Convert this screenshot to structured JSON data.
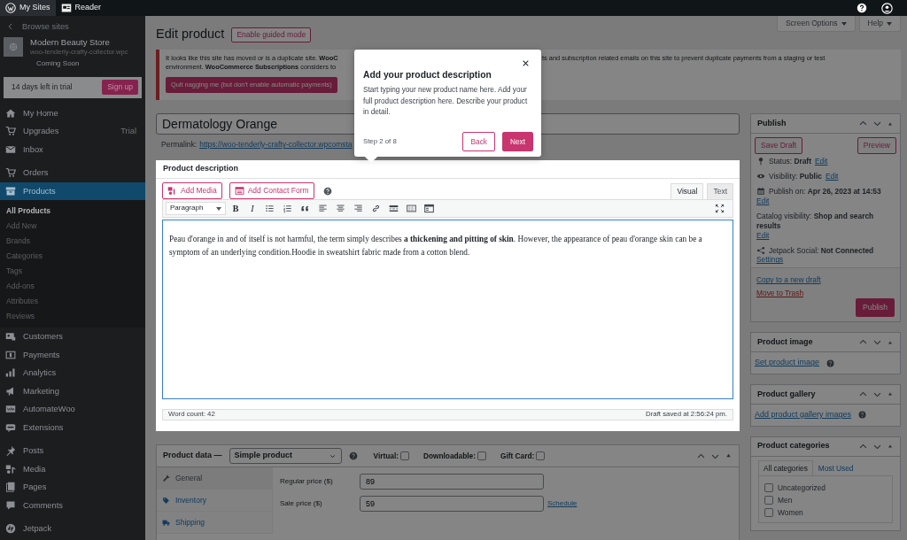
{
  "topbar": {
    "items": [
      {
        "label": "My Sites",
        "selected": true
      },
      {
        "label": "Reader",
        "selected": false
      }
    ]
  },
  "sidebar": {
    "back": "Browse sites",
    "site_name": "Modern Beauty Store",
    "site_url": "woo-tenderly-crafty-collector.wpc",
    "site_status": "Coming Soon",
    "trial_text": "14 days left in trial",
    "trial_button": "Sign up",
    "groups": [
      [
        {
          "label": "My Home",
          "selected": false
        },
        {
          "label": "Upgrades",
          "badge": "Trial",
          "selected": false
        },
        {
          "label": "Inbox",
          "selected": false
        }
      ],
      [
        {
          "label": "Orders",
          "selected": false
        },
        {
          "label": "Products",
          "selected": true,
          "children": [
            {
              "label": "All Products",
              "selected": true
            },
            {
              "label": "Add New",
              "selected": false
            },
            {
              "label": "Brands",
              "selected": false
            },
            {
              "label": "Categories",
              "selected": false
            },
            {
              "label": "Tags",
              "selected": false
            },
            {
              "label": "Add-ons",
              "selected": false
            },
            {
              "label": "Attributes",
              "selected": false
            },
            {
              "label": "Reviews",
              "selected": false
            }
          ]
        },
        {
          "label": "Customers",
          "selected": false
        },
        {
          "label": "Payments",
          "selected": false
        },
        {
          "label": "Analytics",
          "selected": false
        },
        {
          "label": "Marketing",
          "selected": false
        },
        {
          "label": "AutomateWoo",
          "selected": false
        },
        {
          "label": "Extensions",
          "selected": false
        }
      ],
      [
        {
          "label": "Posts",
          "selected": false
        },
        {
          "label": "Media",
          "selected": false
        },
        {
          "label": "Pages",
          "selected": false
        },
        {
          "label": "Comments",
          "selected": false
        }
      ],
      [
        {
          "label": "Jetpack",
          "selected": false
        }
      ]
    ]
  },
  "header": {
    "title": "Edit product",
    "guided_button": "Enable guided mode",
    "tabs": [
      "Screen Options",
      "Help"
    ]
  },
  "notice": {
    "line1_left": "It looks like this site has moved or is a duplicate site. **WooC**",
    "line1_right": "ts and subscription related emails on this site to prevent duplicate payments from a staging or test",
    "line2_left": "environment. **WooCommerce Subscriptions** considers to",
    "button": "Quit nagging me (but don't enable automatic payments)"
  },
  "product_title": "Dermatology Orange",
  "permalink": {
    "label": "Permalink:",
    "url": "https://woo-tenderly-crafty-collector.wpcomsta"
  },
  "description": {
    "heading": "Product description",
    "media_buttons": [
      "Add Media",
      "Add Contact Form"
    ],
    "tabs": [
      {
        "label": "Visual",
        "selected": true
      },
      {
        "label": "Text",
        "selected": false
      }
    ],
    "format": "Paragraph",
    "format_letters": [
      "B",
      "I"
    ],
    "content": "Peau d'orange in and of itself is not harmful, the term simply describes **a thickening and pitting of skin**. However, the appearance of peau d'orange skin can be a symptom of an underlying condition.Hoodie in sweatshirt fabric made from a cotton blend.",
    "word_count": "Word count: 42",
    "saved": "Draft saved at 2:56:24 pm."
  },
  "product_data": {
    "label": "Product data —",
    "type": "Simple product",
    "options": [
      {
        "label": "Virtual:",
        "checked": false
      },
      {
        "label": "Downloadable:",
        "checked": false
      },
      {
        "label": "Gift Card:",
        "checked": false
      }
    ],
    "tabs": [
      {
        "label": "General",
        "selected": true
      },
      {
        "label": "Inventory",
        "selected": false
      },
      {
        "label": "Shipping",
        "selected": false
      }
    ],
    "fields": [
      {
        "label": "Regular price ($)",
        "value": "89"
      },
      {
        "label": "Sale price ($)",
        "value": "59",
        "link": "Schedule"
      }
    ]
  },
  "tour": {
    "title": "Add your product description",
    "body": "Start typing your new product name here. Add your full product description here. Describe your product in detail.",
    "step": "Step 2 of 8",
    "back": "Back",
    "next": "Next"
  },
  "publish": {
    "title": "Publish",
    "save_draft": "Save Draft",
    "preview": "Preview",
    "rows": [
      {
        "text": "Status: **Draft**",
        "link": "Edit"
      },
      {
        "text": "Visibility: **Public**",
        "link": "Edit"
      },
      {
        "text": "Publish on: **Apr 26, 2023 at 14:53**",
        "link": "Edit"
      },
      {
        "text": "Catalog visibility: **Shop and search results**",
        "link": "Edit"
      },
      {
        "text": "Jetpack Social: **Not Connected**",
        "link": "Settings"
      }
    ],
    "copy": "Copy to a new draft",
    "trash": "Move to Trash",
    "button": "Publish"
  },
  "product_image": {
    "title": "Product image",
    "link": "Set product image"
  },
  "product_gallery": {
    "title": "Product gallery",
    "link": "Add product gallery images"
  },
  "categories": {
    "title": "Product categories",
    "tabs": [
      {
        "label": "All categories",
        "selected": true
      },
      {
        "label": "Most Used",
        "selected": false
      }
    ],
    "items": [
      {
        "label": "Uncategorized",
        "checked": false
      },
      {
        "label": "Men",
        "checked": false
      },
      {
        "label": "Women",
        "checked": false
      }
    ]
  }
}
